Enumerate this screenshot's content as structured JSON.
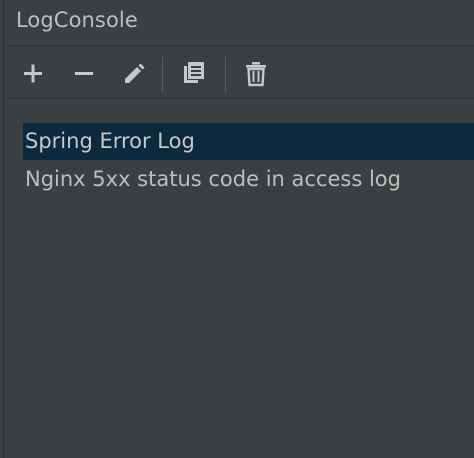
{
  "panel": {
    "title": "LogConsole"
  },
  "toolbar": {
    "buttons": [
      {
        "name": "add",
        "icon": "plus-icon"
      },
      {
        "name": "remove",
        "icon": "minus-icon"
      },
      {
        "name": "edit",
        "icon": "pencil-icon"
      },
      {
        "name": "copy",
        "icon": "copy-icon"
      },
      {
        "name": "delete",
        "icon": "trash-icon"
      }
    ]
  },
  "list": {
    "items": [
      {
        "label": "Spring Error Log",
        "selected": true
      },
      {
        "label": "Nginx 5xx status code in access log",
        "selected": false
      }
    ]
  },
  "colors": {
    "background": "#3c3f41",
    "selection": "#0d293e",
    "text": "#bdbdbd",
    "icon": "#c5c7c9"
  }
}
